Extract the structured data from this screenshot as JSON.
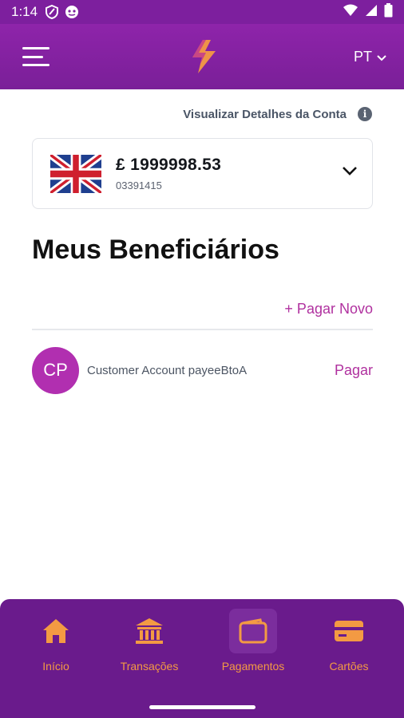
{
  "status_bar": {
    "time": "1:14"
  },
  "header": {
    "language": "PT"
  },
  "account": {
    "view_details_label": "Visualizar Detalhes da Conta",
    "balance": "£ 1999998.53",
    "account_number": "03391415"
  },
  "payees": {
    "title": "Meus Beneficiários",
    "pay_new_label": "+ Pagar Novo",
    "items": [
      {
        "initials": "CP",
        "name": "Customer Account payeeBtoA",
        "action": "Pagar"
      }
    ]
  },
  "nav": {
    "items": [
      {
        "label": "Início",
        "icon": "home-icon"
      },
      {
        "label": "Transações",
        "icon": "bank-icon"
      },
      {
        "label": "Pagamentos",
        "icon": "wallet-icon",
        "active": true
      },
      {
        "label": "Cartões",
        "icon": "card-icon"
      }
    ]
  },
  "colors": {
    "primary": "#7d1f9e",
    "accent": "#b0319f",
    "nav_text": "#f39a43",
    "nav_bg": "#6a1b8c"
  }
}
